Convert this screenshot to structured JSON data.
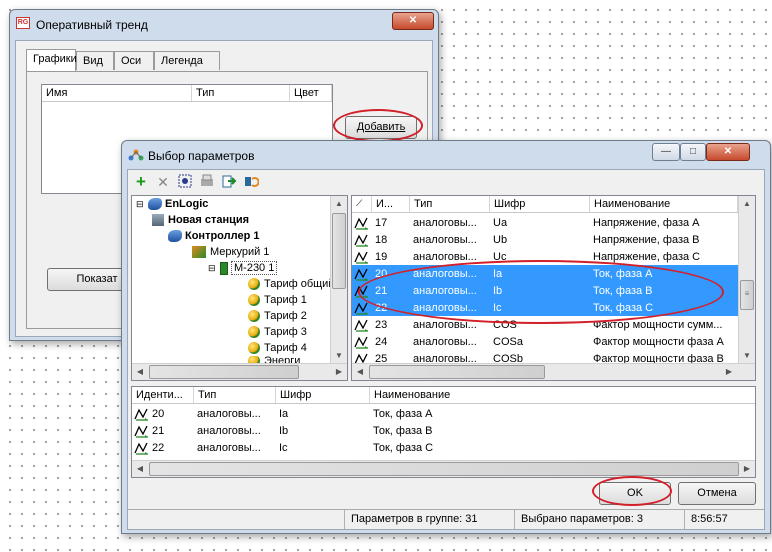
{
  "trend_window": {
    "title": "Оперативный тренд",
    "tabs": [
      "Графики",
      "Вид",
      "Оси",
      "Легенда"
    ],
    "columns": [
      "Имя",
      "Тип",
      "Цвет"
    ],
    "add_button": "Добавить",
    "show_button": "Показат"
  },
  "dialog": {
    "title": "Выбор параметров",
    "window_buttons": {
      "minimize": "—",
      "maximize": "□",
      "close": "✕"
    },
    "toolbar": [
      "add-icon",
      "delete-icon",
      "filter-icon",
      "print-icon",
      "export-icon",
      "refresh-icon"
    ],
    "tree": [
      {
        "label": "EnLogic",
        "bold": true,
        "level": 0,
        "icon": "network-icon"
      },
      {
        "label": "Новая станция",
        "bold": true,
        "level": 1,
        "icon": "computer-icon"
      },
      {
        "label": "Контроллер 1",
        "bold": true,
        "level": 2,
        "icon": "controller-icon"
      },
      {
        "label": "Меркурий 1",
        "bold": false,
        "level": 3,
        "icon": "device-icon"
      },
      {
        "label": "М-230 1",
        "bold": false,
        "level": 4,
        "icon": "meter-icon"
      },
      {
        "label": "Тариф общий",
        "bold": false,
        "level": 5,
        "icon": "tariff-icon"
      },
      {
        "label": "Тариф 1",
        "bold": false,
        "level": 5,
        "icon": "tariff-icon"
      },
      {
        "label": "Тариф 2",
        "bold": false,
        "level": 5,
        "icon": "tariff-icon"
      },
      {
        "label": "Тариф 3",
        "bold": false,
        "level": 5,
        "icon": "tariff-icon"
      },
      {
        "label": "Тариф 4",
        "bold": false,
        "level": 5,
        "icon": "tariff-icon"
      },
      {
        "label": "Энерги",
        "bold": false,
        "level": 5,
        "icon": "tariff-icon"
      }
    ],
    "params_columns": [
      "И...",
      "Тип",
      "Шифр",
      "Наименование"
    ],
    "params_rows": [
      {
        "id": "17",
        "type": "аналоговы...",
        "code": "Ua",
        "name": "Напряжение, фаза A",
        "selected": false
      },
      {
        "id": "18",
        "type": "аналоговы...",
        "code": "Ub",
        "name": "Напряжение, фаза B",
        "selected": false
      },
      {
        "id": "19",
        "type": "аналоговы...",
        "code": "Uc",
        "name": "Напряжение, фаза C",
        "selected": false
      },
      {
        "id": "20",
        "type": "аналоговы...",
        "code": "Ia",
        "name": "Ток, фаза A",
        "selected": true
      },
      {
        "id": "21",
        "type": "аналоговы...",
        "code": "Ib",
        "name": "Ток, фаза B",
        "selected": true
      },
      {
        "id": "22",
        "type": "аналоговы...",
        "code": "Ic",
        "name": "Ток, фаза C",
        "selected": true
      },
      {
        "id": "23",
        "type": "аналоговы...",
        "code": "COS",
        "name": "Фактор мощности сумм...",
        "selected": false
      },
      {
        "id": "24",
        "type": "аналоговы...",
        "code": "COSa",
        "name": "Фактор мощности фаза A",
        "selected": false
      },
      {
        "id": "25",
        "type": "аналоговы...",
        "code": "COSb",
        "name": "Фактор мощности фаза B",
        "selected": false
      }
    ],
    "chosen_columns": [
      "Иденти...",
      "Тип",
      "Шифр",
      "Наименование"
    ],
    "chosen_rows": [
      {
        "id": "20",
        "type": "аналоговы...",
        "code": "Ia",
        "name": "Ток, фаза A"
      },
      {
        "id": "21",
        "type": "аналоговы...",
        "code": "Ib",
        "name": "Ток, фаза B"
      },
      {
        "id": "22",
        "type": "аналоговы...",
        "code": "Ic",
        "name": "Ток, фаза C"
      }
    ],
    "ok_button": "OK",
    "cancel_button": "Отмена",
    "status": {
      "group_count": "Параметров в группе: 31",
      "selected_count": "Выбрано параметров: 3",
      "time": "8:56:57"
    }
  },
  "colors": {
    "selection": "#3399ff",
    "annotation": "#d2202a"
  }
}
